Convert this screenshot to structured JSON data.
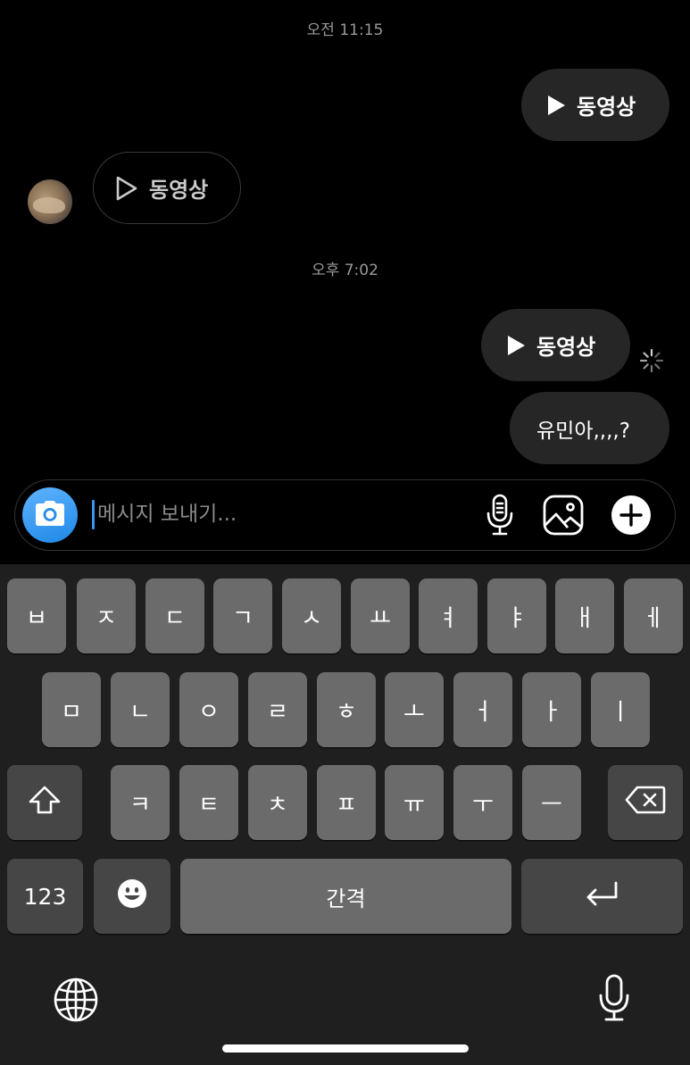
{
  "thread": {
    "timestamps": [
      "오전 11:15",
      "오후 7:02"
    ],
    "messages": [
      {
        "kind": "video",
        "direction": "sent",
        "label": "동영상"
      },
      {
        "kind": "video",
        "direction": "received",
        "label": "동영상"
      },
      {
        "kind": "video",
        "direction": "sent",
        "label": "동영상",
        "status": "sending"
      },
      {
        "kind": "text",
        "direction": "sent",
        "text": "유민아,,,,?"
      }
    ]
  },
  "composer": {
    "placeholder": "메시지 보내기...",
    "value": "",
    "icons": [
      "camera-icon",
      "microphone-icon",
      "gallery-icon",
      "plus-icon"
    ]
  },
  "keyboard": {
    "row1": [
      "ㅂ",
      "ㅈ",
      "ㄷ",
      "ㄱ",
      "ㅅ",
      "ㅛ",
      "ㅕ",
      "ㅑ",
      "ㅐ",
      "ㅔ"
    ],
    "row2": [
      "ㅁ",
      "ㄴ",
      "ㅇ",
      "ㄹ",
      "ㅎ",
      "ㅗ",
      "ㅓ",
      "ㅏ",
      "ㅣ"
    ],
    "row3": [
      "ㅋ",
      "ㅌ",
      "ㅊ",
      "ㅍ",
      "ㅠ",
      "ㅜ",
      "ㅡ"
    ],
    "numbers_label": "123",
    "space_label": "간격",
    "icons": [
      "shift-icon",
      "backspace-icon",
      "emoji-icon",
      "return-icon",
      "globe-icon",
      "dictation-icon"
    ]
  },
  "colors": {
    "background": "#000000",
    "sent_bubble": "#262626",
    "accent": "#3797f0",
    "key": "#6b6b6b",
    "key_dark": "#464646",
    "keyboard_bg": "#1f1f1f"
  }
}
